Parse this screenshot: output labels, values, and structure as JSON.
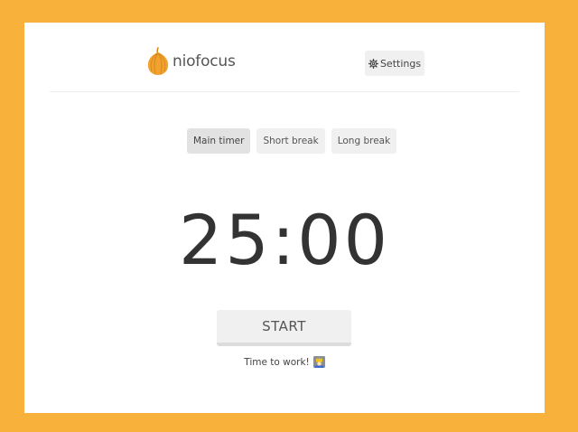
{
  "brand": {
    "name": "niofocus",
    "logo_icon": "garlic-icon"
  },
  "header": {
    "settings_label": "Settings",
    "settings_icon": "gear-icon"
  },
  "modes": [
    {
      "label": "Main timer",
      "active": true
    },
    {
      "label": "Short break",
      "active": false
    },
    {
      "label": "Long break",
      "active": false
    }
  ],
  "timer": {
    "display": "25:00"
  },
  "controls": {
    "start_label": "START"
  },
  "status": {
    "message": "Time to work!",
    "emoji_icon": "worker-emoji-icon"
  },
  "colors": {
    "background": "#F8B13A",
    "card": "#FFFFFF",
    "button": "#F0F0F0",
    "button_active": "#E2E2E2",
    "text": "#333333",
    "logo": "#F2A22E"
  }
}
